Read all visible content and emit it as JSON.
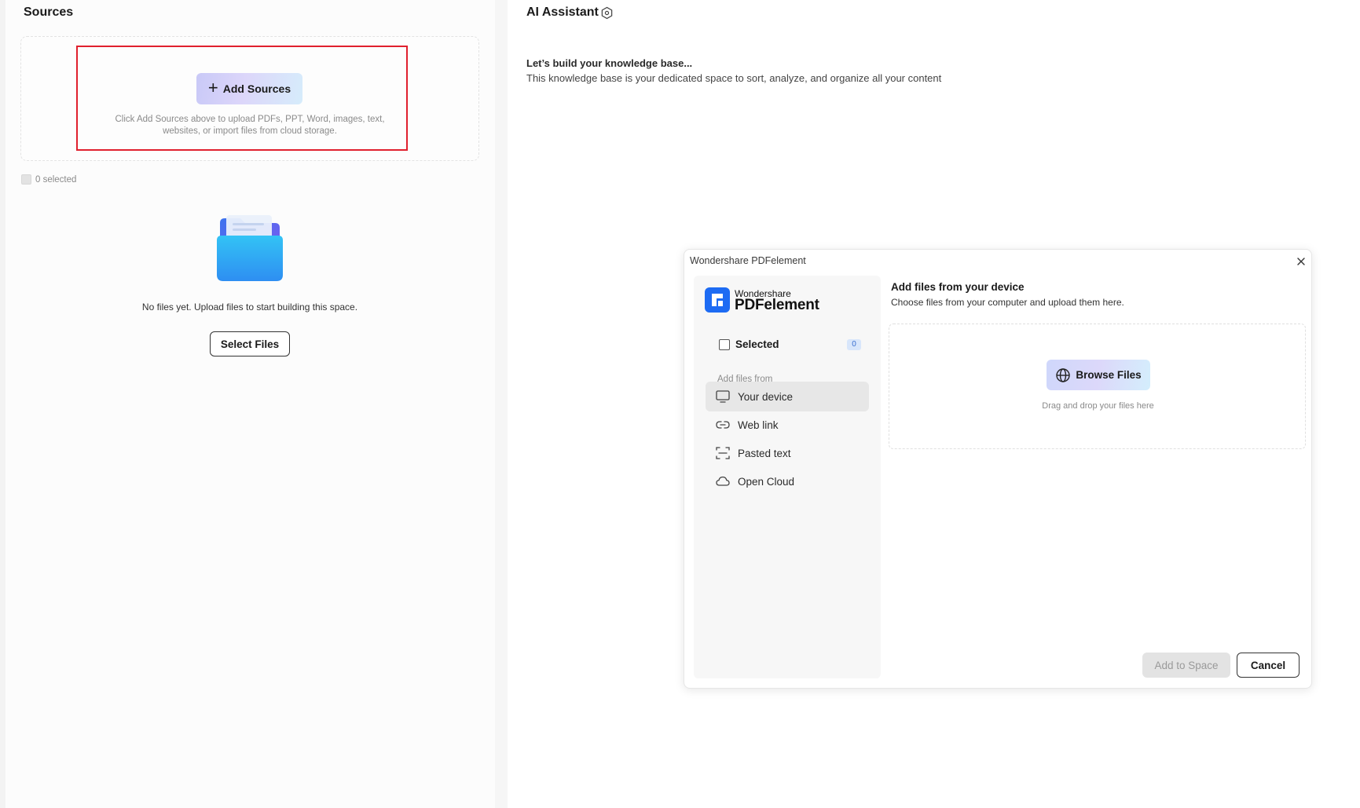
{
  "sources": {
    "title": "Sources",
    "add_sources_label": "Add Sources",
    "upload_hint": "Click Add Sources above to upload PDFs, PPT, Word, images, text, websites, or import files from cloud storage.",
    "selected_count": "0 selected",
    "empty_message": "No files yet. Upload files to start building this space.",
    "select_files_label": "Select Files"
  },
  "assistant": {
    "title": "AI Assistant",
    "kb_heading": "Let’s build your knowledge base...",
    "kb_description": "This knowledge base is your dedicated space to sort, analyze, and organize all your content"
  },
  "dialog": {
    "window_title": "Wondershare PDFelement",
    "brand_small": "Wondershare",
    "brand_big": "PDFelement",
    "selected_label": "Selected",
    "selected_badge": "0",
    "section_label": "Add files from",
    "sources": [
      {
        "label": "Your device",
        "icon": "monitor-icon",
        "active": true
      },
      {
        "label": "Web link",
        "icon": "link-icon",
        "active": false
      },
      {
        "label": "Pasted text",
        "icon": "text-scan-icon",
        "active": false
      },
      {
        "label": "Open Cloud",
        "icon": "cloud-icon",
        "active": false
      }
    ],
    "heading": "Add files from your device",
    "subheading": "Choose files from your computer and upload them here.",
    "browse_label": "Browse Files",
    "drop_hint": "Drag and drop your files here",
    "add_to_space_label": "Add to Space",
    "cancel_label": "Cancel"
  },
  "colors": {
    "highlight": "#e0202e",
    "brand_blue": "#1d6bf3"
  }
}
